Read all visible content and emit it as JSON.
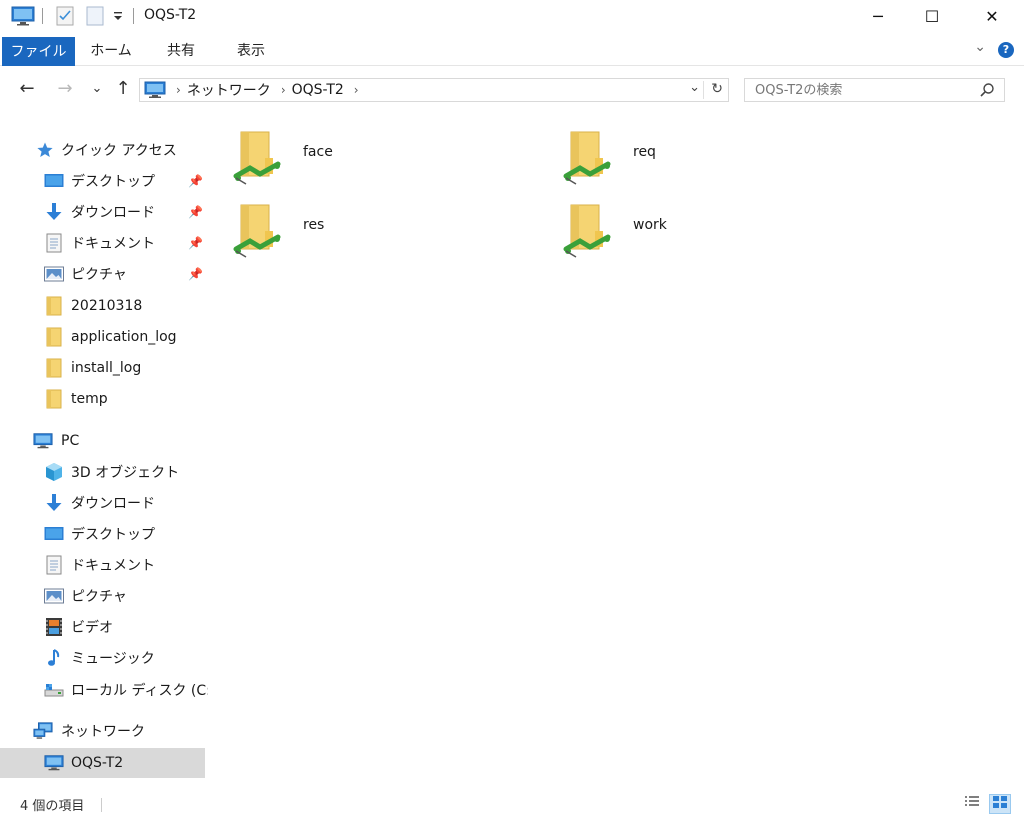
{
  "window": {
    "title": "OQS-T2",
    "controls": {
      "minimize": "─",
      "maximize": "☐",
      "close": "✕"
    }
  },
  "ribbon": {
    "tabs": [
      "ファイル",
      "ホーム",
      "共有",
      "表示"
    ],
    "help": "?",
    "expand": "⌄"
  },
  "nav": {
    "back": "←",
    "forward": "→",
    "recent": "⌄",
    "up": "↑",
    "address": {
      "crumbs": [
        "ネットワーク",
        "OQS-T2"
      ],
      "separator": "›"
    },
    "dropdown": "⌄",
    "refresh": "↻"
  },
  "search": {
    "placeholder": "OQS-T2の検索"
  },
  "sidebar": {
    "quick_access": {
      "label": "クイック アクセス",
      "items": [
        {
          "label": "デスクトップ",
          "icon": "desktop-icon",
          "pinned": true
        },
        {
          "label": "ダウンロード",
          "icon": "download-icon",
          "pinned": true
        },
        {
          "label": "ドキュメント",
          "icon": "document-icon",
          "pinned": true
        },
        {
          "label": "ピクチャ",
          "icon": "picture-icon",
          "pinned": true
        },
        {
          "label": "20210318",
          "icon": "folder-icon",
          "pinned": false
        },
        {
          "label": "application_log",
          "icon": "folder-icon",
          "pinned": false
        },
        {
          "label": "install_log",
          "icon": "folder-icon",
          "pinned": false
        },
        {
          "label": "temp",
          "icon": "folder-icon",
          "pinned": false
        }
      ]
    },
    "pc": {
      "label": "PC",
      "items": [
        {
          "label": "3D オブジェクト",
          "icon": "3d-objects-icon"
        },
        {
          "label": "ダウンロード",
          "icon": "download-icon"
        },
        {
          "label": "デスクトップ",
          "icon": "desktop-icon"
        },
        {
          "label": "ドキュメント",
          "icon": "document-icon"
        },
        {
          "label": "ピクチャ",
          "icon": "picture-icon"
        },
        {
          "label": "ビデオ",
          "icon": "video-icon"
        },
        {
          "label": "ミュージック",
          "icon": "music-icon"
        },
        {
          "label": "ローカル ディスク (C:)",
          "icon": "local-disk-icon"
        }
      ]
    },
    "network": {
      "label": "ネットワーク",
      "items": [
        {
          "label": "OQS-T2",
          "icon": "computer-icon",
          "selected": true
        }
      ]
    }
  },
  "content": {
    "folders": [
      {
        "name": "face"
      },
      {
        "name": "req"
      },
      {
        "name": "res"
      },
      {
        "name": "work"
      }
    ]
  },
  "status": {
    "item_count": "4 個の項目"
  },
  "colors": {
    "accent": "#1a67bf",
    "folder": "#f5d472",
    "share": "#3aa03a",
    "selected": "#d9d9d9"
  }
}
